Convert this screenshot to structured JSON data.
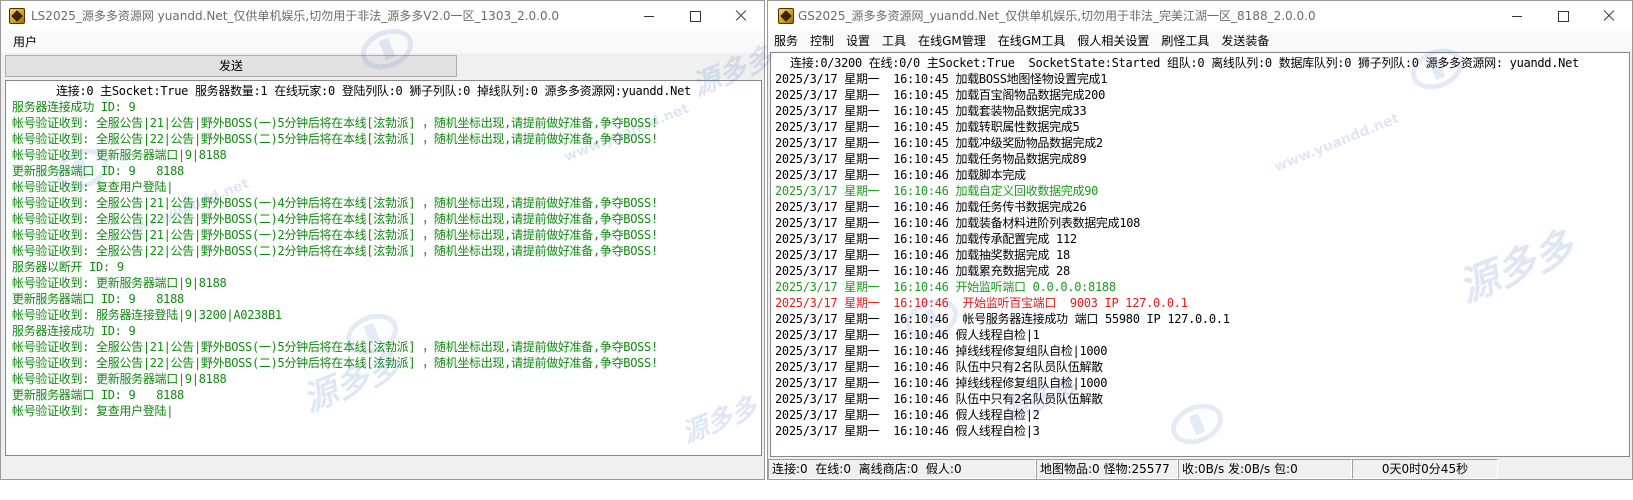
{
  "left_window": {
    "title": "LS2025_源多多资源网 yuandd.Net_仅供单机娱乐,切勿用于非法_源多多V2.0一区_1303_2.0.0.0",
    "menu": {
      "user": "用户"
    },
    "send_button": "发送",
    "status_line": "连接:0 主Socket:True 服务器数量:1 在线玩家:0 登陆列队:0 狮子列队:0 掉线队列:0 源多多资源网:yuandd.Net",
    "log": [
      {
        "text": "服务器连接成功 ID: 9",
        "color": "#118a11"
      },
      {
        "text": "帐号验证收到: 全服公告|21|公告|野外BOSS(一)5分钟后将在本线[泫勃派] ，随机坐标出现,请提前做好准备,争夺BOSS!",
        "color": "#118a11"
      },
      {
        "text": "帐号验证收到: 全服公告|22|公告|野外BOSS(二)5分钟后将在本线[泫勃派] ，随机坐标出现,请提前做好准备,争夺BOSS!",
        "color": "#118a11"
      },
      {
        "text": "帐号验证收到: 更新服务器端口|9|8188",
        "color": "#118a11"
      },
      {
        "text": "更新服务器端口 ID: 9   8188",
        "color": "#118a11"
      },
      {
        "text": "帐号验证收到: 复查用户登陆|",
        "color": "#118a11"
      },
      {
        "text": "帐号验证收到: 全服公告|21|公告|野外BOSS(一)4分钟后将在本线[泫勃派] ，随机坐标出现,请提前做好准备,争夺BOSS!",
        "color": "#118a11"
      },
      {
        "text": "帐号验证收到: 全服公告|22|公告|野外BOSS(二)4分钟后将在本线[泫勃派] ，随机坐标出现,请提前做好准备,争夺BOSS!",
        "color": "#118a11"
      },
      {
        "text": "帐号验证收到: 全服公告|21|公告|野外BOSS(一)2分钟后将在本线[泫勃派] ，随机坐标出现,请提前做好准备,争夺BOSS!",
        "color": "#118a11"
      },
      {
        "text": "帐号验证收到: 全服公告|22|公告|野外BOSS(二)2分钟后将在本线[泫勃派] ，随机坐标出现,请提前做好准备,争夺BOSS!",
        "color": "#118a11"
      },
      {
        "text": "服务器以断开 ID: 9",
        "color": "#118a11"
      },
      {
        "text": "帐号验证收到: 更新服务器端口|9|8188",
        "color": "#118a11"
      },
      {
        "text": "更新服务器端口 ID: 9   8188",
        "color": "#118a11"
      },
      {
        "text": "帐号验证收到: 服务器连接登陆|9|3200|A0238B1",
        "color": "#118a11"
      },
      {
        "text": "服务器连接成功 ID: 9",
        "color": "#118a11"
      },
      {
        "text": "帐号验证收到: 全服公告|21|公告|野外BOSS(一)5分钟后将在本线[泫勃派] ，随机坐标出现,请提前做好准备,争夺BOSS!",
        "color": "#118a11"
      },
      {
        "text": "帐号验证收到: 全服公告|22|公告|野外BOSS(二)5分钟后将在本线[泫勃派] ，随机坐标出现,请提前做好准备,争夺BOSS!",
        "color": "#118a11"
      },
      {
        "text": "帐号验证收到: 更新服务器端口|9|8188",
        "color": "#118a11"
      },
      {
        "text": "更新服务器端口 ID: 9   8188",
        "color": "#118a11"
      },
      {
        "text": "帐号验证收到: 复查用户登陆|",
        "color": "#118a11"
      }
    ]
  },
  "right_window": {
    "title": "GS2025_源多多资源网_yuandd.Net_仅供单机娱乐,切勿用于非法_完美江湖一区_8188_2.0.0.0",
    "menu": {
      "service": "服务",
      "control": "控制",
      "settings": "设置",
      "tools": "工具",
      "online_gm_manage": "在线GM管理",
      "online_gm_tools": "在线GM工具",
      "bot_settings": "假人相关设置",
      "spawn_tools": "刷怪工具",
      "send_equipment": "发送装备"
    },
    "status_line": "连接:0/3200 在线:0/0 主Socket:True  SocketState:Started 组队:0 离线队列:0 数据库队列:0 狮子列队:0 源多多资源网: yuandd.Net",
    "log": [
      {
        "text": "2025/3/17 星期一  16:10:45 加载BOSS地图怪物设置完成1",
        "color": "#000000"
      },
      {
        "text": "2025/3/17 星期一  16:10:45 加载百宝阁物品数据完成200",
        "color": "#000000"
      },
      {
        "text": "2025/3/17 星期一  16:10:45 加载套装物品数据完成33",
        "color": "#000000"
      },
      {
        "text": "2025/3/17 星期一  16:10:45 加载转职属性数据完成5",
        "color": "#000000"
      },
      {
        "text": "2025/3/17 星期一  16:10:45 加载冲级奖励物品数据完成2",
        "color": "#000000"
      },
      {
        "text": "2025/3/17 星期一  16:10:45 加载任务物品数据完成89",
        "color": "#000000"
      },
      {
        "text": "2025/3/17 星期一  16:10:46 加载脚本完成",
        "color": "#000000"
      },
      {
        "text": "2025/3/17 星期一  16:10:46 加载自定义回收数据完成90",
        "color": "#1c9a1c"
      },
      {
        "text": "2025/3/17 星期一  16:10:46 加载任务传书数据完成26",
        "color": "#000000"
      },
      {
        "text": "2025/3/17 星期一  16:10:46 加载装备材料进阶列表数据完成108",
        "color": "#000000"
      },
      {
        "text": "2025/3/17 星期一  16:10:46 加载传承配置完成 112",
        "color": "#000000"
      },
      {
        "text": "2025/3/17 星期一  16:10:46 加载抽奖数据完成 18",
        "color": "#000000"
      },
      {
        "text": "2025/3/17 星期一  16:10:46 加载累充数据完成 28",
        "color": "#000000"
      },
      {
        "text": "2025/3/17 星期一  16:10:46 开始监听端口 0.0.0.0:8188",
        "color": "#1c9a1c"
      },
      {
        "text": "2025/3/17 星期一  16:10:46  开始监听百宝端口  9003 IP 127.0.0.1",
        "color": "#e31b1b"
      },
      {
        "text": "2025/3/17 星期一  16:10:46  帐号服务器连接成功 端口 55980 IP 127.0.0.1",
        "color": "#000000"
      },
      {
        "text": "2025/3/17 星期一  16:10:46 假人线程自检|1",
        "color": "#000000"
      },
      {
        "text": "2025/3/17 星期一  16:10:46 掉线线程修复组队自检|1000",
        "color": "#000000"
      },
      {
        "text": "2025/3/17 星期一  16:10:46 队伍中只有2名队员队伍解散",
        "color": "#000000"
      },
      {
        "text": "2025/3/17 星期一  16:10:46 掉线线程修复组队自检|1000",
        "color": "#000000"
      },
      {
        "text": "2025/3/17 星期一  16:10:46 队伍中只有2名队员队伍解散",
        "color": "#000000"
      },
      {
        "text": "2025/3/17 星期一  16:10:46 假人线程自检|2",
        "color": "#000000"
      },
      {
        "text": "2025/3/17 星期一  16:10:46 假人线程自检|3",
        "color": "#000000"
      }
    ],
    "statusbar": {
      "connections": "连接:0  在线:0  离线商店:0  假人:0",
      "map": "地图物品:0 怪物:25577",
      "traffic": "收:0B/s 发:0B/s 包:0",
      "uptime": "0天0时0分45秒"
    }
  },
  "watermark": {
    "brand": "源多多",
    "url": "www.yuandd.net",
    "color": "#466ebe"
  },
  "icons": {
    "app": "app-icon",
    "minimize": "minimize-icon",
    "maximize": "maximize-icon",
    "close": "close-icon",
    "watermark_logo": "watermark-logo-icon"
  }
}
